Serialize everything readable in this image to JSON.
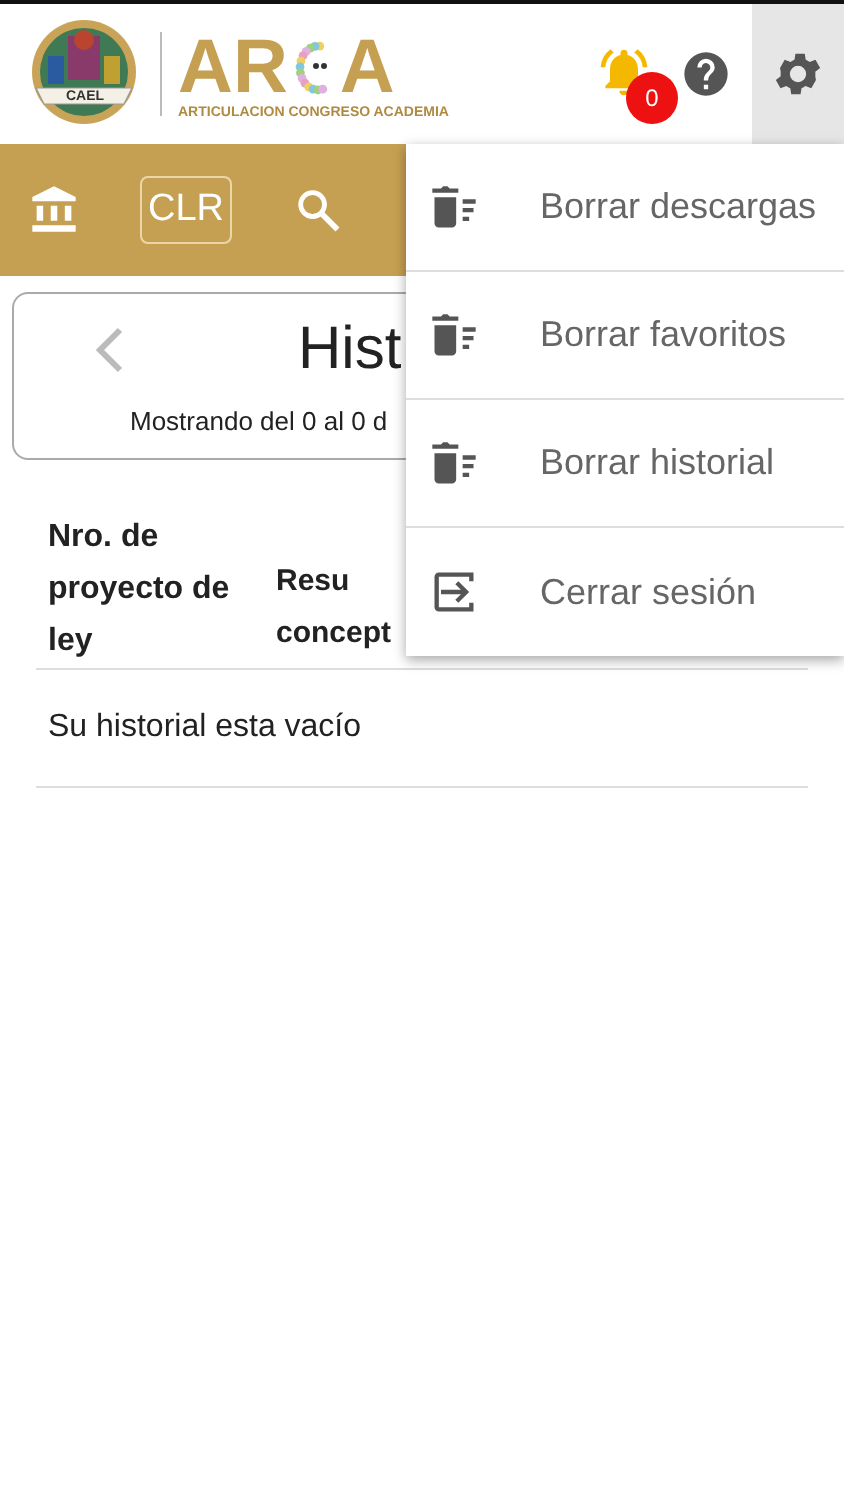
{
  "header": {
    "logo": {
      "seal_label": "CAEL",
      "wordmark_left": "AR",
      "wordmark_right": "A",
      "tagline": "ARTICULACION CONGRESO ACADEMIA"
    },
    "notifications": {
      "count": "0"
    },
    "settings": {
      "selected": true
    }
  },
  "nav": {
    "items": [
      {
        "kind": "bank"
      },
      {
        "kind": "text",
        "label": "CLR"
      },
      {
        "kind": "search"
      }
    ]
  },
  "card": {
    "title": "Hist",
    "subtitle": "Mostrando del 0 al 0 d"
  },
  "table": {
    "columns": [
      "Nro. de proyecto de ley",
      "Resu concept"
    ],
    "empty_message": "Su historial esta vacío"
  },
  "menu": {
    "items": [
      {
        "kind": "delete",
        "label": "Borrar descargas"
      },
      {
        "kind": "delete",
        "label": "Borrar favoritos"
      },
      {
        "kind": "delete",
        "label": "Borrar historial"
      },
      {
        "kind": "logout",
        "label": "Cerrar sesión"
      }
    ]
  }
}
